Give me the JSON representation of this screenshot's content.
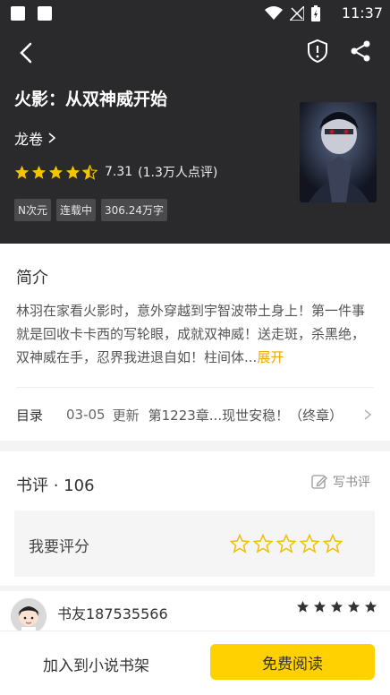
{
  "status_bar": {
    "time": "11:37"
  },
  "book": {
    "title": "火影：从双神威开始",
    "author": "龙卷",
    "rating": "7.31",
    "rating_count": "(1.3万人点评)",
    "rating_stars": 4.5,
    "tags": [
      "N次元",
      "连载中",
      "306.24万字"
    ]
  },
  "intro": {
    "heading": "简介",
    "text": "林羽在家看火影时，意外穿越到宇智波带土身上！第一件事就是回收卡卡西的写轮眼，成就双神威！送走斑，杀黑绝，双神威在手，忍界我进退自如！柱间体...",
    "expand": "展开"
  },
  "toc": {
    "label": "目录",
    "date": "03-05",
    "update": "更新",
    "chapter": "第1223章...现世安稳！（终章）"
  },
  "reviews": {
    "heading": "书评 · 106",
    "write": "写书评",
    "rate_label": "我要评分",
    "reviewer": {
      "name": "书友187535566",
      "stars": 5
    }
  },
  "bottom": {
    "add_shelf": "加入到小说书架",
    "read": "免费阅读"
  },
  "colors": {
    "accent": "#ffd100",
    "header_bg": "#2a2a2c",
    "star": "#f5c400",
    "expand": "#f0a800"
  }
}
